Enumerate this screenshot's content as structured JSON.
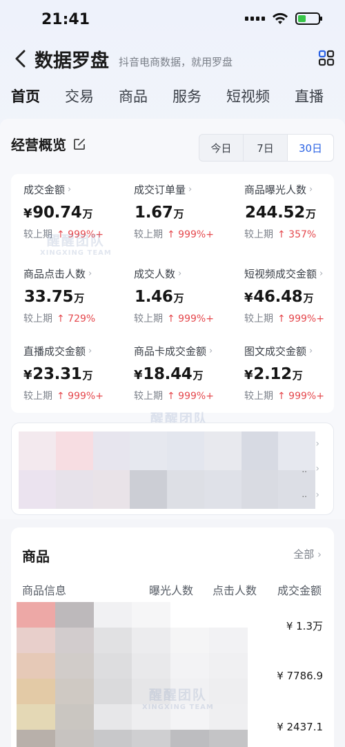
{
  "status_bar": {
    "time": "21:41"
  },
  "header": {
    "title": "数据罗盘",
    "subtitle": "抖音电商数据，就用罗盘"
  },
  "tabs": [
    {
      "label": "首页",
      "active": true
    },
    {
      "label": "交易"
    },
    {
      "label": "商品"
    },
    {
      "label": "服务"
    },
    {
      "label": "短视频"
    },
    {
      "label": "直播"
    }
  ],
  "overview": {
    "title": "经营概览",
    "ranges": [
      "今日",
      "7日",
      "30日"
    ],
    "selected_range": "30日",
    "compare_label": "较上期",
    "metrics": [
      {
        "label": "成交金额",
        "currency": "¥",
        "value": "90.74",
        "unit": "万",
        "change": "↑ 999%+"
      },
      {
        "label": "成交订单量",
        "currency": "",
        "value": "1.67",
        "unit": "万",
        "change": "↑ 999%+"
      },
      {
        "label": "商品曝光人数",
        "currency": "",
        "value": "244.52",
        "unit": "万",
        "change": "↑ 357%"
      },
      {
        "label": "商品点击人数",
        "currency": "",
        "value": "33.75",
        "unit": "万",
        "change": "↑ 729%"
      },
      {
        "label": "成交人数",
        "currency": "",
        "value": "1.46",
        "unit": "万",
        "change": "↑ 999%+"
      },
      {
        "label": "短视频成交金额",
        "currency": "¥",
        "value": "46.48",
        "unit": "万",
        "change": "↑ 999%+"
      },
      {
        "label": "直播成交金额",
        "currency": "¥",
        "value": "23.31",
        "unit": "万",
        "change": "↑ 999%+"
      },
      {
        "label": "商品卡成交金额",
        "currency": "¥",
        "value": "18.44",
        "unit": "万",
        "change": "↑ 999%+"
      },
      {
        "label": "图文成交金额",
        "currency": "¥",
        "value": "2.12",
        "unit": "万",
        "change": "↑ 999%+"
      }
    ]
  },
  "watermark": {
    "cn": "醒醒团队",
    "en": "XINGXING TEAM"
  },
  "products": {
    "title": "商品",
    "all_label": "全部",
    "columns": [
      "商品信息",
      "曝光人数",
      "点击人数",
      "成交金额"
    ],
    "amounts": [
      "¥ 1.3万",
      "¥ 7786.9",
      "¥ 2437.1"
    ]
  },
  "colors": {
    "accent": "#2a62e4",
    "increase": "#e5484d"
  },
  "icons": [
    "back-icon",
    "grid-icon",
    "edit-icon",
    "chevron-right-icon",
    "signal-icon",
    "wifi-icon",
    "battery-icon"
  ]
}
